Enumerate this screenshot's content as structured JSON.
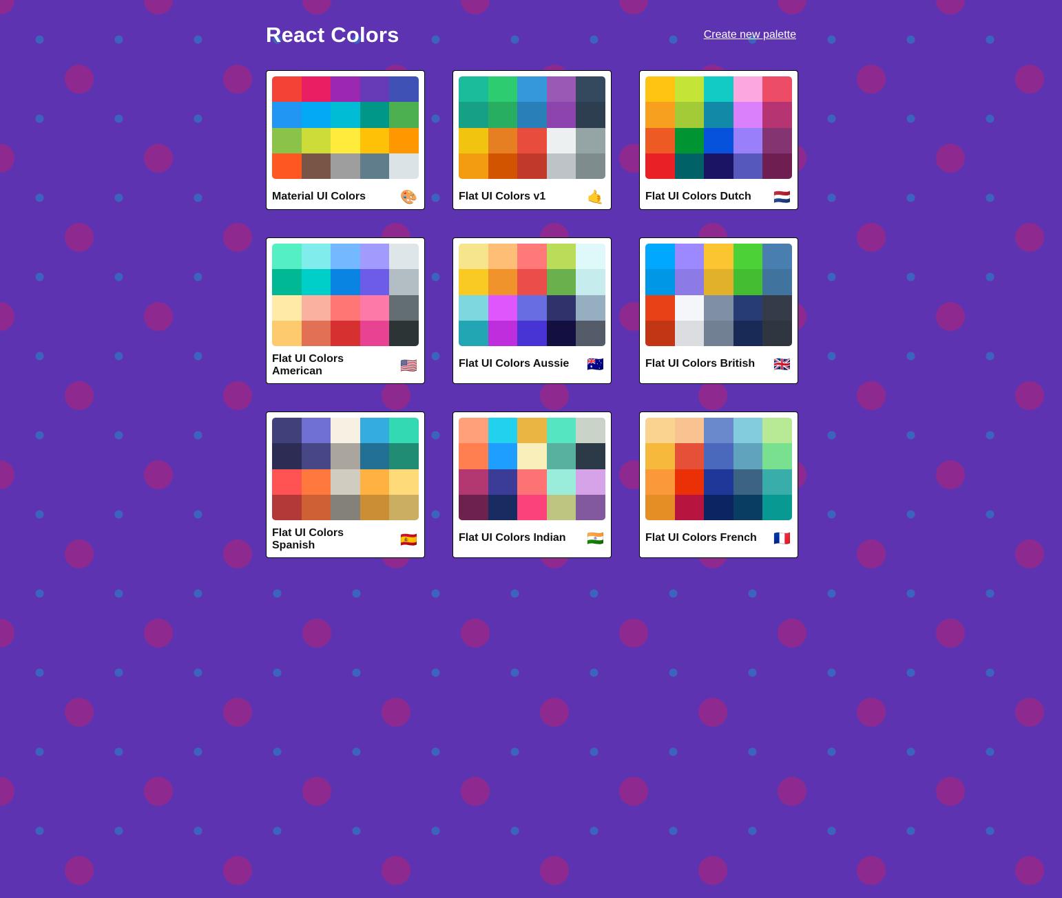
{
  "header": {
    "title": "React Colors",
    "create_link": "Create new palette"
  },
  "colors": {
    "background": "#5d33b2",
    "big_dot": "#8e2a8f",
    "small_dot": "#3c63bd"
  },
  "palettes": [
    {
      "name": "Material UI Colors",
      "emoji": "🎨",
      "colors": [
        "#f44336",
        "#e91e63",
        "#9c27b0",
        "#673ab7",
        "#3f51b5",
        "#2196f3",
        "#03a9f4",
        "#00bcd4",
        "#009688",
        "#4caf50",
        "#8bc34a",
        "#cddc39",
        "#ffeb3b",
        "#ffc107",
        "#ff9800",
        "#ff5722",
        "#795548",
        "#9e9e9e",
        "#607d8b",
        "#dce3e6"
      ]
    },
    {
      "name": "Flat UI Colors v1",
      "emoji": "🤙",
      "colors": [
        "#1abc9c",
        "#2ecc71",
        "#3498db",
        "#9b59b6",
        "#34495e",
        "#16a085",
        "#27ae60",
        "#2980b9",
        "#8e44ad",
        "#2c3e50",
        "#f1c40f",
        "#e67e22",
        "#e74c3c",
        "#ecf0f1",
        "#95a5a6",
        "#f39c12",
        "#d35400",
        "#c0392b",
        "#bdc3c7",
        "#7f8c8d"
      ]
    },
    {
      "name": "Flat UI Colors Dutch",
      "emoji": "🇳🇱",
      "colors": [
        "#ffc312",
        "#c4e538",
        "#12cbc4",
        "#fda7df",
        "#ed4c67",
        "#f79f1f",
        "#a3cb38",
        "#1289a7",
        "#d980fa",
        "#b53471",
        "#ee5a24",
        "#009432",
        "#0652dd",
        "#9980fa",
        "#833471",
        "#ea2027",
        "#006266",
        "#1b1464",
        "#5758bb",
        "#6f1e51"
      ]
    },
    {
      "name": "Flat UI Colors American",
      "emoji": "🇺🇸",
      "colors": [
        "#55efc4",
        "#81ecec",
        "#74b9ff",
        "#a29bfe",
        "#dfe6e9",
        "#00b894",
        "#00cec9",
        "#0984e3",
        "#6c5ce7",
        "#b2bec3",
        "#ffeaa7",
        "#fab1a0",
        "#ff7675",
        "#fd79a8",
        "#636e72",
        "#fdcb6e",
        "#e17055",
        "#d63031",
        "#e84393",
        "#2d3436"
      ]
    },
    {
      "name": "Flat UI Colors Aussie",
      "emoji": "🇦🇺",
      "colors": [
        "#f6e58d",
        "#ffbe76",
        "#ff7979",
        "#badc58",
        "#dff9fb",
        "#f9ca24",
        "#f0932b",
        "#eb4d4b",
        "#6ab04c",
        "#c7ecee",
        "#7ed6df",
        "#e056fd",
        "#686de0",
        "#30336b",
        "#95afc0",
        "#22a6b3",
        "#be2edd",
        "#4834d4",
        "#130f40",
        "#535c68"
      ]
    },
    {
      "name": "Flat UI Colors British",
      "emoji": "🇬🇧",
      "colors": [
        "#00a8ff",
        "#9c88ff",
        "#fbc531",
        "#4cd137",
        "#487eb0",
        "#0097e6",
        "#8c7ae6",
        "#e1b12c",
        "#44bd32",
        "#40739e",
        "#e84118",
        "#f5f6fa",
        "#7f8fa6",
        "#273c75",
        "#353b48",
        "#c23616",
        "#dcdde1",
        "#718093",
        "#192a56",
        "#2f3640"
      ]
    },
    {
      "name": "Flat UI Colors Spanish",
      "emoji": "🇪🇸",
      "colors": [
        "#40407a",
        "#706fd3",
        "#f7f1e3",
        "#34ace0",
        "#33d9b2",
        "#2c2c54",
        "#474787",
        "#aaa69d",
        "#227093",
        "#218c74",
        "#ff5252",
        "#ff793f",
        "#d1ccc0",
        "#ffb142",
        "#ffda79",
        "#b33939",
        "#cd6133",
        "#84817a",
        "#cc8e35",
        "#ccae62"
      ]
    },
    {
      "name": "Flat UI Colors Indian",
      "emoji": "🇮🇳",
      "colors": [
        "#ffa07a",
        "#22d1ee",
        "#eab543",
        "#55e6c1",
        "#cad3c8",
        "#ff7f50",
        "#1e9fff",
        "#f8efba",
        "#58b19f",
        "#2c3a47",
        "#b33771",
        "#3b3b98",
        "#fd7272",
        "#9aecdb",
        "#d6a2e8",
        "#6d214f",
        "#182c61",
        "#fc427b",
        "#bdc581",
        "#82589f"
      ]
    },
    {
      "name": "Flat UI Colors French",
      "emoji": "🇫🇷",
      "colors": [
        "#fad390",
        "#f8c291",
        "#6a89cc",
        "#82ccdd",
        "#b8e994",
        "#f6b93b",
        "#e55039",
        "#4a69bd",
        "#60a3bc",
        "#78e08f",
        "#fa983a",
        "#eb2f06",
        "#1e3799",
        "#3c6382",
        "#38ada9",
        "#e58e26",
        "#b71540",
        "#0c2461",
        "#0a3d62",
        "#079992"
      ]
    }
  ]
}
